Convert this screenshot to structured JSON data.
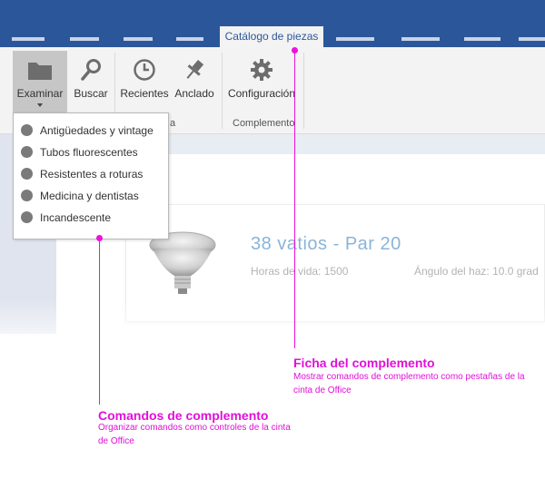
{
  "tabs": {
    "active_label": "Catálogo de piezas"
  },
  "ribbon": {
    "buttons": [
      {
        "label": "Examinar",
        "icon": "folder-icon"
      },
      {
        "label": "Buscar",
        "icon": "search-icon"
      },
      {
        "label": "Recientes",
        "icon": "clock-icon"
      },
      {
        "label": "Anclado",
        "icon": "pin-icon"
      },
      {
        "label": "Configuración",
        "icon": "gear-icon"
      }
    ],
    "group_label_partial": "a",
    "group_label_complemento": "Complemento"
  },
  "dropdown": {
    "items": [
      "Antigüedades y vintage",
      "Tubos fluorescentes",
      "Resistentes a roturas",
      "Medicina y dentistas",
      "Incandescente"
    ]
  },
  "item": {
    "title": "38 vatios - Par 20",
    "life_label": "Horas de vida: ",
    "life_value": "1500",
    "beam_label": "Ángulo del haz: ",
    "beam_value": "10.0 grad"
  },
  "callouts": {
    "addin_tab": {
      "title": "Ficha del complemento",
      "desc": "Mostrar comandos de complemento como pestañas de la cinta de Office"
    },
    "addin_commands": {
      "title": "Comandos de complemento",
      "desc": "Organizar comandos como controles de la cinta de Office"
    }
  },
  "colors": {
    "accent_blue": "#2b579a",
    "callout_magenta": "#ee11dd",
    "title_blue": "#8ab4d8"
  }
}
